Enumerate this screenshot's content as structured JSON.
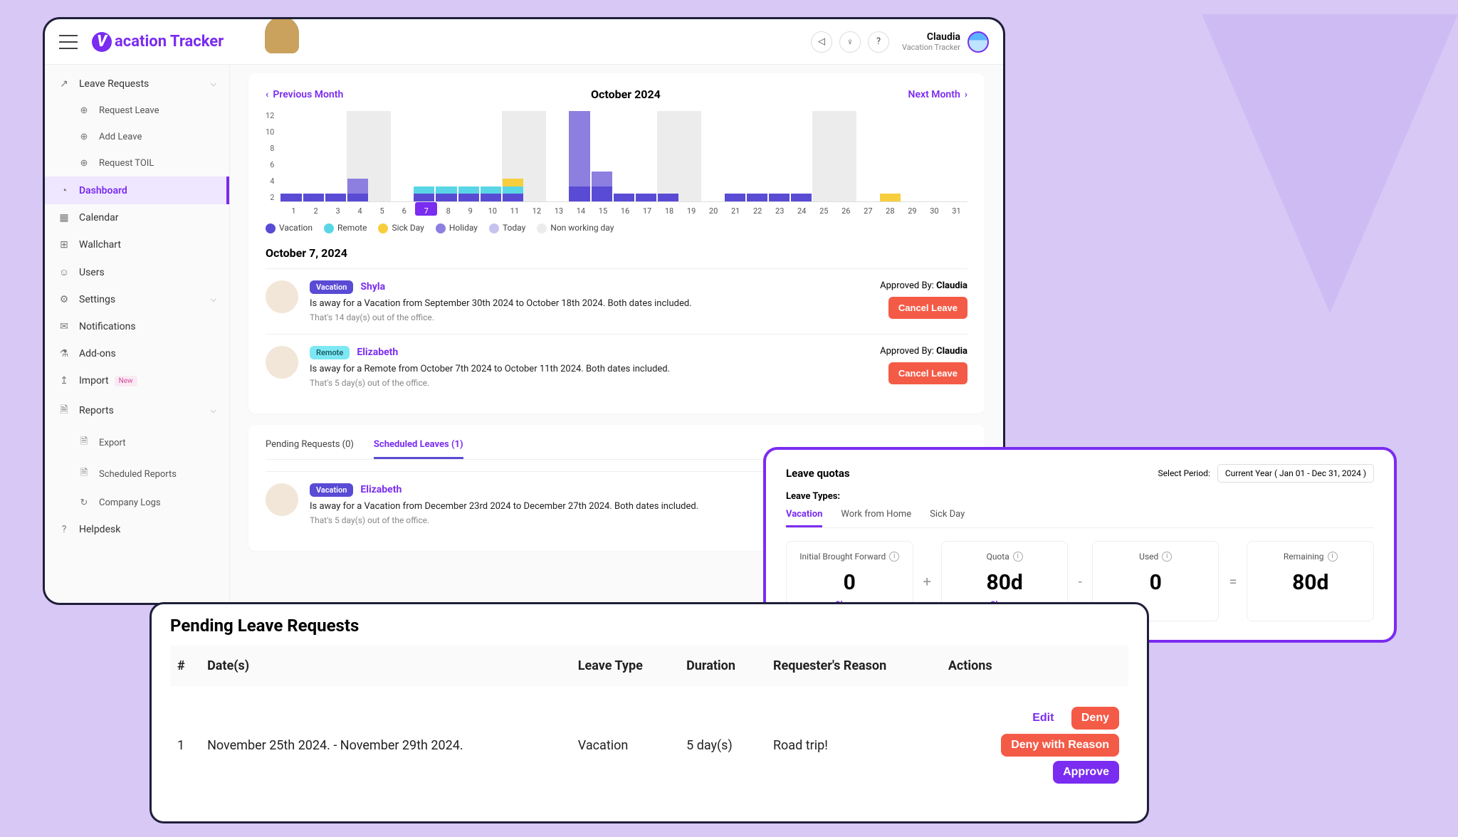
{
  "app": {
    "name": "acation Tracker",
    "logo_letter": "V"
  },
  "user": {
    "name": "Claudia",
    "sub": "Vacation Tracker"
  },
  "sidebar": {
    "groups": [
      {
        "label": "Leave Requests",
        "icon": "↗",
        "expandable": true
      },
      {
        "label": "Request Leave",
        "icon": "⊕",
        "sub": true
      },
      {
        "label": "Add Leave",
        "icon": "⊕",
        "sub": true
      },
      {
        "label": "Request TOIL",
        "icon": "⊕",
        "sub": true
      },
      {
        "label": "Dashboard",
        "icon": "◔",
        "active": true
      },
      {
        "label": "Calendar",
        "icon": "▦"
      },
      {
        "label": "Wallchart",
        "icon": "⊞"
      },
      {
        "label": "Users",
        "icon": "☺"
      },
      {
        "label": "Settings",
        "icon": "⚙",
        "expandable": true
      },
      {
        "label": "Notifications",
        "icon": "✉"
      },
      {
        "label": "Add-ons",
        "icon": "⚗"
      },
      {
        "label": "Import",
        "icon": "↥",
        "badge": "New"
      },
      {
        "label": "Reports",
        "icon": "🗎",
        "expandable": true
      },
      {
        "label": "Export",
        "icon": "🗎",
        "sub": true
      },
      {
        "label": "Scheduled Reports",
        "icon": "🗎",
        "sub": true
      },
      {
        "label": "Company Logs",
        "icon": "↻",
        "sub": true
      },
      {
        "label": "Helpdesk",
        "icon": "?"
      }
    ]
  },
  "month": {
    "prev": "Previous Month",
    "next": "Next Month",
    "title": "October 2024"
  },
  "chart_data": {
    "type": "bar",
    "title": "October 2024",
    "xlabel": "",
    "ylabel": "",
    "ylim": [
      0,
      12
    ],
    "y_ticks": [
      12,
      10,
      8,
      6,
      4,
      2
    ],
    "categories": [
      1,
      2,
      3,
      4,
      5,
      6,
      7,
      8,
      9,
      10,
      11,
      12,
      13,
      14,
      15,
      16,
      17,
      18,
      19,
      20,
      21,
      22,
      23,
      24,
      25,
      26,
      27,
      28,
      29,
      30,
      31
    ],
    "today_index": 6,
    "non_working": [
      4,
      5,
      11,
      12,
      18,
      19,
      25,
      26
    ],
    "series": [
      {
        "name": "Vacation",
        "color": "#5a4bd4",
        "values": [
          1,
          1,
          1,
          1,
          0,
          0,
          1,
          1,
          1,
          1,
          1,
          0,
          0,
          2,
          2,
          1,
          1,
          1,
          0,
          0,
          1,
          1,
          1,
          1,
          0,
          0,
          0,
          0,
          0,
          0,
          0
        ]
      },
      {
        "name": "Remote",
        "color": "#59d6e6",
        "values": [
          0,
          0,
          0,
          0,
          0,
          0,
          1,
          1,
          1,
          1,
          1,
          0,
          0,
          0,
          0,
          0,
          0,
          0,
          0,
          0,
          0,
          0,
          0,
          0,
          0,
          0,
          0,
          0,
          0,
          0,
          0
        ]
      },
      {
        "name": "Sick Day",
        "color": "#f7ce3e",
        "values": [
          0,
          0,
          0,
          0,
          0,
          0,
          0,
          0,
          0,
          0,
          1,
          0,
          0,
          0,
          0,
          0,
          0,
          0,
          0,
          0,
          0,
          0,
          0,
          0,
          0,
          0,
          0,
          1,
          0,
          0,
          0
        ]
      },
      {
        "name": "Holiday",
        "color": "#8c7fe0",
        "values": [
          0,
          0,
          0,
          2,
          0,
          0,
          0,
          0,
          0,
          0,
          0,
          0,
          0,
          10,
          2,
          0,
          0,
          0,
          0,
          0,
          0,
          0,
          0,
          0,
          0,
          0,
          0,
          0,
          0,
          0,
          0
        ]
      }
    ],
    "legend_extra": [
      "Today",
      "Non working day"
    ]
  },
  "selected_date": "October 7, 2024",
  "entries": [
    {
      "pill": "Vacation",
      "pill_class": "vac",
      "name": "Shyla",
      "desc": "Is away for a Vacation from September 30th 2024 to October 18th 2024. Both dates included.",
      "sub": "That's 14 day(s) out of the office.",
      "approved_by": "Claudia",
      "hair": "hair1"
    },
    {
      "pill": "Remote",
      "pill_class": "rem",
      "name": "Elizabeth",
      "desc": "Is away for a Remote from October 7th 2024 to October 11th 2024. Both dates included.",
      "sub": "That's 5 day(s) out of the office.",
      "approved_by": "Claudia",
      "hair": "hair2"
    }
  ],
  "approved_by_label": "Approved By:",
  "cancel_label": "Cancel Leave",
  "tabs": {
    "pending": "Pending Requests (0)",
    "scheduled": "Scheduled Leaves (1)"
  },
  "scheduled_entry": {
    "pill": "Vacation",
    "pill_class": "vac",
    "name": "Elizabeth",
    "desc": "Is away for a Vacation from December 23rd 2024 to December 27th 2024. Both dates included.",
    "sub": "That's 5 day(s) out of the office.",
    "hair": "hair2"
  },
  "quotas": {
    "title": "Leave quotas",
    "period_label": "Select Period:",
    "period_value": "Current Year ( Jan 01 - Dec 31, 2024 )",
    "types_label": "Leave Types:",
    "type_tabs": [
      "Vacation",
      "Work from Home",
      "Sick Day"
    ],
    "boxes": [
      {
        "label": "Initial Brought Forward",
        "value": "0",
        "change": "Change"
      },
      {
        "label": "Quota",
        "value": "80d",
        "change": "Change"
      },
      {
        "label": "Used",
        "value": "0"
      },
      {
        "label": "Remaining",
        "value": "80d"
      }
    ],
    "ops": [
      "+",
      "-",
      "="
    ]
  },
  "pending": {
    "title": "Pending Leave Requests",
    "headers": [
      "#",
      "Date(s)",
      "Leave Type",
      "Duration",
      "Requester's Reason",
      "Actions"
    ],
    "rows": [
      {
        "num": "1",
        "dates": "November 25th 2024. - November 29th 2024.",
        "type": "Vacation",
        "duration": "5 day(s)",
        "reason": "Road trip!"
      }
    ],
    "actions": {
      "edit": "Edit",
      "deny": "Deny",
      "deny_reason": "Deny with Reason",
      "approve": "Approve"
    }
  }
}
